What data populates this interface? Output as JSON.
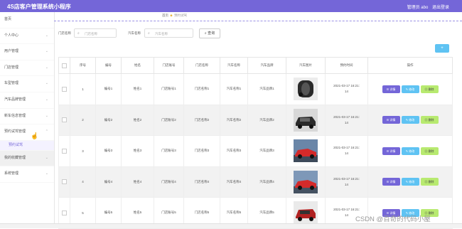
{
  "header": {
    "app_title": "4S店客户管理系统小程序",
    "user": "管理员 abo",
    "logout": "退出登录"
  },
  "sidebar": {
    "items": [
      {
        "label": "首页"
      },
      {
        "label": "个人中心"
      },
      {
        "label": "用户管理"
      },
      {
        "label": "门店管理"
      },
      {
        "label": "车型管理"
      },
      {
        "label": "汽车品牌管理"
      },
      {
        "label": "新车信息管理"
      },
      {
        "label": "预约试驾管理"
      },
      {
        "label": "预约试驾"
      },
      {
        "label": "我的收藏管理"
      },
      {
        "label": "系统管理"
      }
    ]
  },
  "breadcrumb": {
    "home": "首页",
    "current": "预约试驾"
  },
  "search": {
    "label1": "门店名称",
    "placeholder1": "门店名称",
    "label2": "汽车名称",
    "placeholder2": "汽车名称",
    "button": "查询"
  },
  "add_button": "+",
  "table": {
    "columns": [
      "",
      "序号",
      "编号",
      "姓名",
      "门店账号",
      "门店名称",
      "汽车名称",
      "汽车品牌",
      "汽车图片",
      "预约时间",
      "操作"
    ],
    "rows": [
      {
        "index": "1",
        "code": "编号1",
        "name": "姓名1",
        "store_account": "门店账号1",
        "store_name": "门店名称1",
        "car_name": "汽车名称1",
        "brand": "汽车品牌1",
        "time_date": "2021-03-17 16:21:",
        "time_sec": "14",
        "image": "car-dark-sedan"
      },
      {
        "index": "2",
        "code": "编号2",
        "name": "姓名2",
        "store_account": "门店账号2",
        "store_name": "门店名称2",
        "car_name": "汽车名称2",
        "brand": "汽车品牌2",
        "time_date": "2021-03-17 16:21:",
        "time_sec": "14",
        "image": "car-dark-suv"
      },
      {
        "index": "3",
        "code": "编号3",
        "name": "姓名3",
        "store_account": "门店账号3",
        "store_name": "门店名称3",
        "car_name": "汽车名称3",
        "brand": "汽车品牌3",
        "time_date": "2021-03-17 16:21:",
        "time_sec": "14",
        "image": "car-red-coupe"
      },
      {
        "index": "4",
        "code": "编号4",
        "name": "姓名4",
        "store_account": "门店账号4",
        "store_name": "门店名称4",
        "car_name": "汽车名称4",
        "brand": "汽车品牌4",
        "time_date": "2021-03-17 16:21:",
        "time_sec": "14",
        "image": "car-red-coupe"
      },
      {
        "index": "5",
        "code": "编号5",
        "name": "姓名5",
        "store_account": "门店账号5",
        "store_name": "门店名称5",
        "car_name": "汽车名称5",
        "brand": "汽车品牌5",
        "time_date": "2021-03-17 16:21:",
        "time_sec": "14",
        "image": "car-red-suv"
      }
    ],
    "actions": {
      "detail": "详情",
      "edit": "修改",
      "delete": "删除"
    }
  },
  "watermark": "CSDN @百奇的代码小屋",
  "colors": {
    "primary": "#7466d8",
    "info": "#5fc3f3",
    "success": "#b8ea70"
  }
}
